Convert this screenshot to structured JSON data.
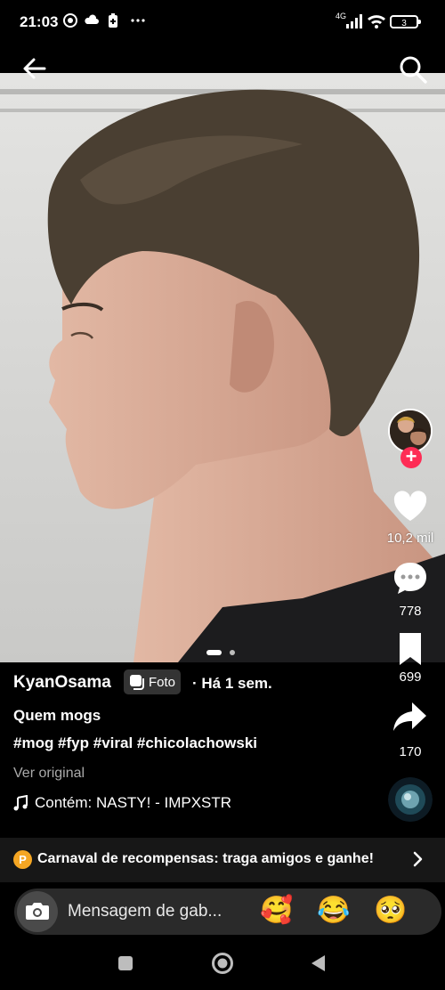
{
  "status": {
    "time": "21:03",
    "network": "4G",
    "battery": "3"
  },
  "header": {
    "back_icon": "arrow-left-icon",
    "search_icon": "search-icon"
  },
  "rail": {
    "likes": "10,2 mil",
    "comments": "778",
    "saves": "699",
    "shares": "170"
  },
  "post": {
    "author": "KyanOsama",
    "type_badge": "Foto",
    "age": "· Há 1 sem.",
    "title": "Quem mogs",
    "hashtags": "#mog #fyp #viral #chicolachowski",
    "view_original": "Ver original",
    "music": "Contém: NASTY! - IMPXSTR",
    "page_indicator": {
      "current": 1,
      "total": 2
    }
  },
  "promo": {
    "coin": "P",
    "text": "Carnaval de recompensas: traga amigos e ganhe!"
  },
  "message_bar": {
    "placeholder": "Mensagem de gab...",
    "emojis": [
      "🥰",
      "😂",
      "🥺"
    ]
  },
  "colors": {
    "accent": "#fe2c55",
    "promo_coin": "#f5a623",
    "background": "#000000"
  }
}
